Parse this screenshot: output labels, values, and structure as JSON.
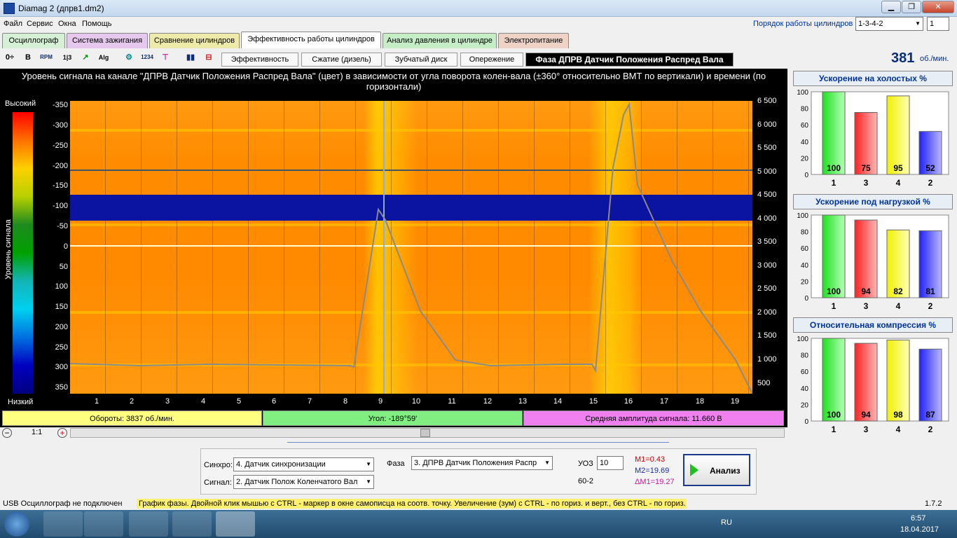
{
  "window": {
    "title": "Diamag 2 (дпрв1.dm2)",
    "min": "▁",
    "max": "❐",
    "close": "✕"
  },
  "menu": [
    "Файл",
    "Сервис",
    "Окна",
    "Помощь"
  ],
  "cylinder_order": {
    "label": "Порядок работы цилиндров",
    "value": "1-3-4-2",
    "num": "1"
  },
  "tabs": [
    "Осциллограф",
    "Система зажигания",
    "Сравнение цилиндров",
    "Эффективность работы цилиндров",
    "Анализ давления в цилиндре",
    "Электропитание"
  ],
  "subtabs": [
    "Эффективность",
    "Сжатие (дизель)",
    "Зубчатый диск",
    "Опережение",
    "Фаза ДПРВ Датчик Положения Распред Вала"
  ],
  "toolbar": [
    "0÷",
    "B",
    "RPM",
    "1|3",
    "↗",
    "Alg",
    "⚙",
    "1234",
    "⊤",
    "▮▮",
    "⊟"
  ],
  "rpm": {
    "value": "381",
    "unit": "об./мин."
  },
  "chart": {
    "title": "Уровень сигнала на канале \"ДПРВ Датчик Положения Распред Вала\" (цвет) в зависимости от угла поворота колен-вала (±360° относительно ВМТ по вертикали) и времени (по горизонтали)",
    "scale_high": "Высокий",
    "scale_low": "Низкий",
    "scale_axis": "Уровень сигнала",
    "y_left": [
      "-350",
      "-300",
      "-250",
      "-200",
      "-150",
      "-100",
      "-50",
      "0",
      "50",
      "100",
      "150",
      "200",
      "250",
      "300",
      "350"
    ],
    "y_right": [
      "6 500",
      "6 000",
      "5 500",
      "5 000",
      "4 500",
      "4 000",
      "3 500",
      "3 000",
      "2 500",
      "2 000",
      "1 500",
      "1 000",
      "500"
    ],
    "x_ticks": [
      "1",
      "2",
      "3",
      "4",
      "5",
      "6",
      "7",
      "8",
      "9",
      "10",
      "11",
      "12",
      "13",
      "14",
      "15",
      "16",
      "17",
      "18",
      "19"
    ]
  },
  "status": {
    "rpm": "Обороты:  3837 об./мин.",
    "angle": "Угол:  -189°59'",
    "amp": "Средняя амплитуда сигнала:  11.660 В"
  },
  "zoom": "1:1",
  "right_panel": [
    {
      "title": "Ускорение на холостых %",
      "cyl": [
        "1",
        "3",
        "4",
        "2"
      ],
      "values": [
        100,
        75,
        95,
        52
      ]
    },
    {
      "title": "Ускорение под нагрузкой %",
      "cyl": [
        "1",
        "3",
        "4",
        "2"
      ],
      "values": [
        100,
        94,
        82,
        81
      ]
    },
    {
      "title": "Относительная компрессия %",
      "cyl": [
        "1",
        "3",
        "4",
        "2"
      ],
      "values": [
        100,
        94,
        98,
        87
      ]
    }
  ],
  "rp_axis": [
    "100",
    "80",
    "60",
    "40",
    "20",
    "0"
  ],
  "controls": {
    "sync_label": "Синхро:",
    "sync_value": "4.  Датчик синхронизации",
    "signal_label": "Сигнал:",
    "signal_value": "2.  Датчик Полож Коленчатого Вал",
    "phase_label": "Фаза",
    "phase_value": "3.  ДПРВ Датчик Положения Распр",
    "uoz_label": "УОЗ",
    "uoz_value": "10",
    "teeth": "60-2",
    "m1": "M1=0.43",
    "m2": "M2=19.69",
    "dm1": "ΔM1=19.27",
    "analyze": "Анализ"
  },
  "hint": "График фазы. Двойной клик мышью с CTRL - маркер в окне самописца на соотв. точку. Увеличение (зум) с CTRL - по гориз. и верт., без CTRL - по гориз.",
  "usb": "USB Осциллограф не подключен",
  "version": "1.7.2",
  "taskbar": {
    "lang": "RU",
    "time": "6:57",
    "date": "18.04.2017"
  },
  "colors": {
    "orange": "#ff8c00",
    "blue_band": "#0a14a0",
    "cyl1": "#22ff22",
    "cyl3": "#ff3030",
    "cyl4": "#ffff00",
    "cyl2": "#3030ff"
  }
}
